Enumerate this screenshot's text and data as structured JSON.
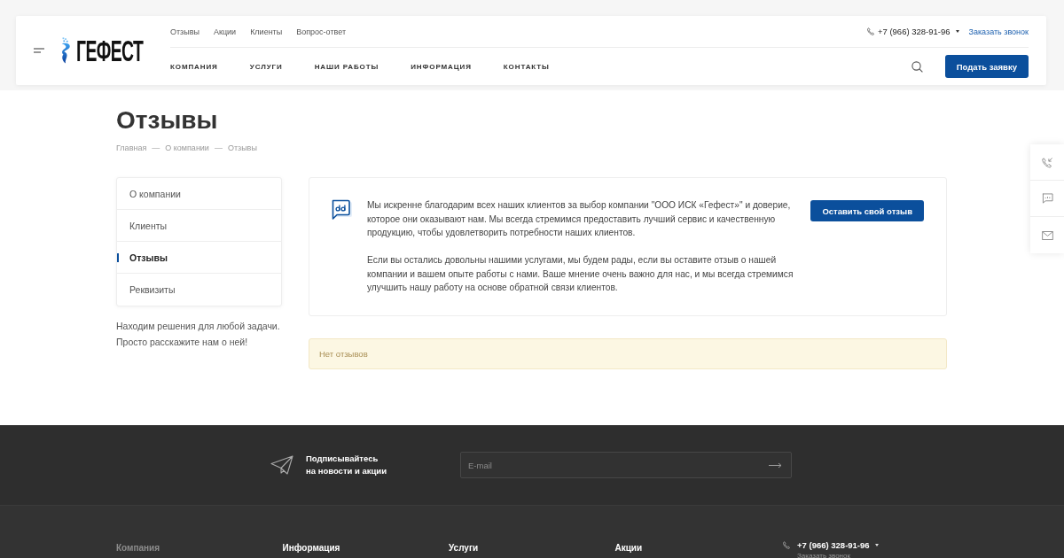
{
  "header": {
    "logo": "ГЕФЕСТ",
    "top_links": [
      "Отзывы",
      "Акции",
      "Клиенты",
      "Вопрос-ответ"
    ],
    "nav": [
      "КОМПАНИЯ",
      "УСЛУГИ",
      "НАШИ РАБОТЫ",
      "ИНФОРМАЦИЯ",
      "КОНТАКТЫ"
    ],
    "phone": "+7 (966) 328-91-96",
    "callback_link": "Заказать звонок",
    "cta_button": "Подать заявку"
  },
  "page": {
    "title": "Отзывы",
    "breadcrumbs": [
      "Главная",
      "О компании",
      "Отзывы"
    ],
    "breadcrumb_separator": "—"
  },
  "sidebar": {
    "items": [
      {
        "label": "О компании",
        "selected": false
      },
      {
        "label": "Клиенты",
        "selected": false
      },
      {
        "label": "Отзывы",
        "selected": true
      },
      {
        "label": "Реквизиты",
        "selected": false
      }
    ],
    "note": "Находим решения для любой задачи. Просто расскажите нам о ней!"
  },
  "intro": {
    "paragraphs": [
      "Мы искренне благодарим всех наших клиентов за выбор компании \"ООО ИСК «Гефест»\" и доверие, которое они оказывают нам. Мы всегда стремимся предоставить лучший сервис и качественную продукцию, чтобы удовлетворить потребности наших клиентов.",
      "Если вы остались довольны нашими услугами, мы будем рады, если вы оставите отзыв о нашей компании и вашем опыте работы с нами. Ваше мнение очень важно для нас, и мы всегда стремимся улучшить нашу работу на основе обратной связи клиентов."
    ],
    "button": "Оставить свой отзыв"
  },
  "notice": {
    "text": "Нет отзывов"
  },
  "subscribe": {
    "title": "Подписывайтесь\nна новости и акции",
    "email_field": {
      "placeholder": "E-mail"
    }
  },
  "footer": {
    "columns": [
      {
        "label": "Компания",
        "selected": true
      },
      {
        "label": "Информация",
        "selected": false
      },
      {
        "label": "Услуги",
        "selected": false
      },
      {
        "label": "Акции",
        "selected": false
      }
    ],
    "phone": "+7 (966) 328-91-96",
    "callback_link": "Заказать звонок"
  }
}
